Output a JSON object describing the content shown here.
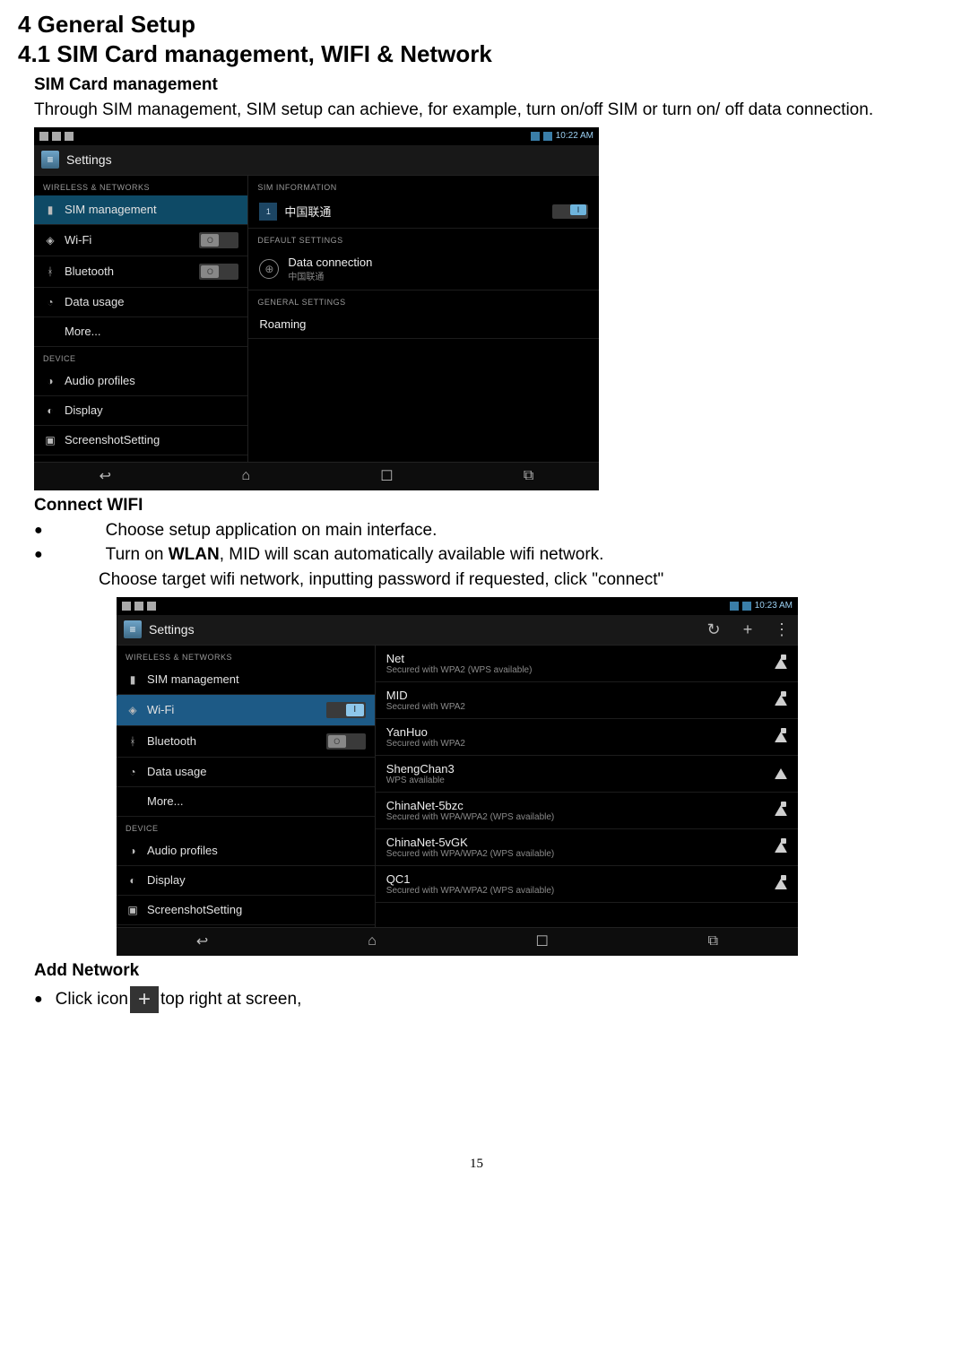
{
  "headings": {
    "h1": "4 General Setup",
    "h2": "4.1 SIM Card management, WIFI & Network",
    "sim_mgmt": "SIM Card management",
    "connect_wifi": "Connect WIFI",
    "add_network": "Add Network"
  },
  "paragraphs": {
    "sim_intro": "Through SIM management, SIM setup can achieve, for example, turn on/off SIM or turn on/ off data connection.",
    "wifi_b1": "Choose setup application on main interface.",
    "wifi_b2_pre": "Turn on ",
    "wifi_b2_bold": "WLAN",
    "wifi_b2_post": ", MID will scan automatically available wifi network.",
    "wifi_line3": "Choose target wifi network, inputting password if requested, click \"connect\"",
    "addnet_pre": "Click icon",
    "addnet_post": "  top right at screen,"
  },
  "page_number": "15",
  "screenshot1": {
    "time": "10:22 AM",
    "title": "Settings",
    "left_section1": "WIRELESS & NETWORKS",
    "left_items": {
      "sim": "SIM management",
      "wifi": "Wi-Fi",
      "bt": "Bluetooth",
      "data": "Data usage",
      "more": "More..."
    },
    "left_section2": "DEVICE",
    "left_device": {
      "audio": "Audio profiles",
      "display": "Display",
      "screenshot": "ScreenshotSetting"
    },
    "right_section1": "SIM INFORMATION",
    "sim_name": "中国联通",
    "sim_slot": "1",
    "right_section2": "DEFAULT SETTINGS",
    "dc_title": "Data connection",
    "dc_sub": "中国联通",
    "right_section3": "GENERAL SETTINGS",
    "roaming": "Roaming"
  },
  "screenshot2": {
    "time": "10:23 AM",
    "title": "Settings",
    "left_section1": "WIRELESS & NETWORKS",
    "left_items": {
      "sim": "SIM management",
      "wifi": "Wi-Fi",
      "bt": "Bluetooth",
      "data": "Data usage",
      "more": "More..."
    },
    "left_section2": "DEVICE",
    "left_device": {
      "audio": "Audio profiles",
      "display": "Display",
      "screenshot": "ScreenshotSetting"
    },
    "networks": [
      {
        "name": "Net",
        "sub": "Secured with WPA2 (WPS available)",
        "lock": true
      },
      {
        "name": "MID",
        "sub": "Secured with WPA2",
        "lock": true
      },
      {
        "name": "YanHuo",
        "sub": "Secured with WPA2",
        "lock": true
      },
      {
        "name": "ShengChan3",
        "sub": "WPS available",
        "lock": false
      },
      {
        "name": "ChinaNet-5bzc",
        "sub": "Secured with WPA/WPA2 (WPS available)",
        "lock": true
      },
      {
        "name": "ChinaNet-5vGK",
        "sub": "Secured with WPA/WPA2 (WPS available)",
        "lock": true
      },
      {
        "name": "QC1",
        "sub": "Secured with WPA/WPA2 (WPS available)",
        "lock": true
      }
    ]
  }
}
